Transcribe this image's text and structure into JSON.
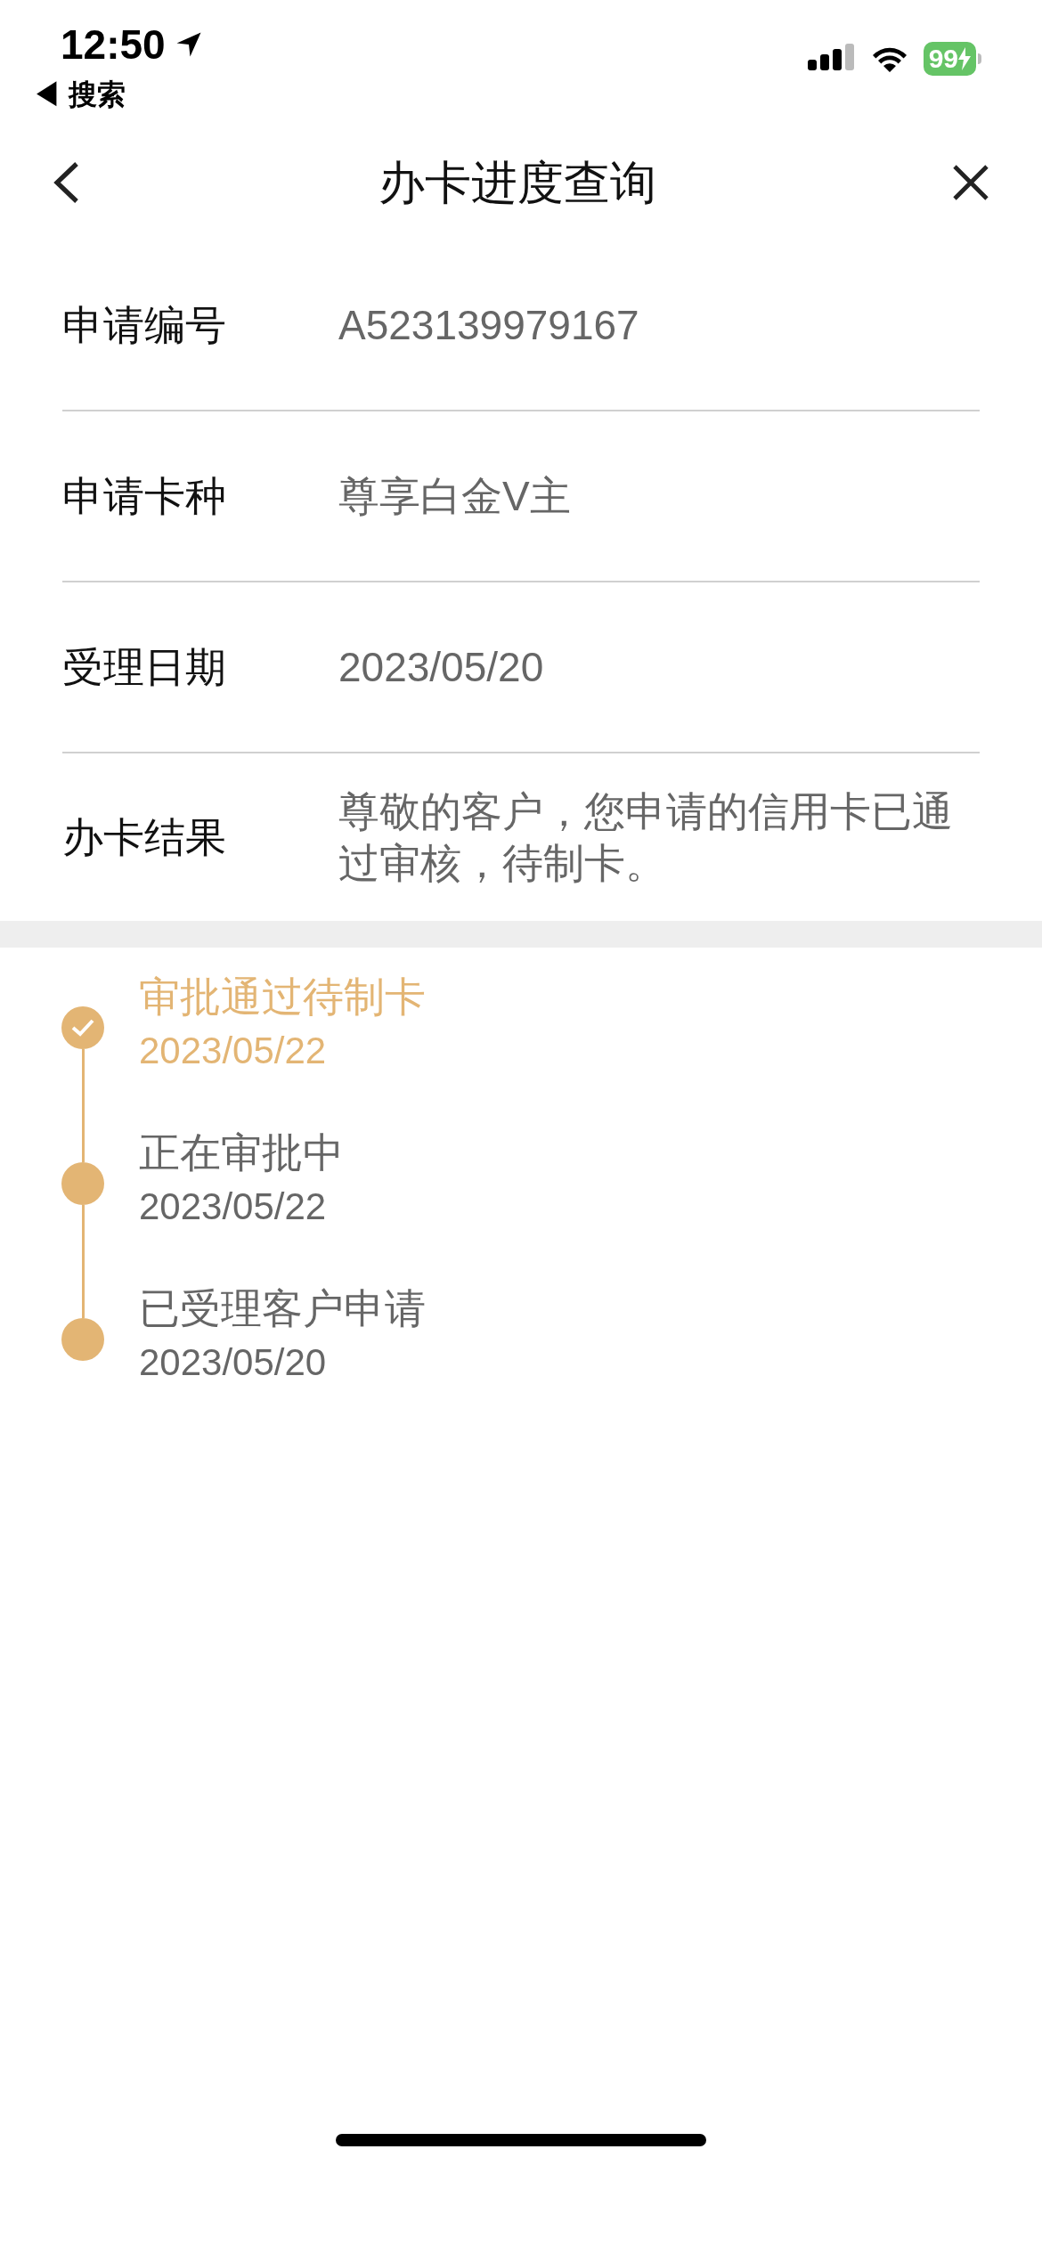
{
  "status_bar": {
    "time": "12:50",
    "back_label": "◀ 搜索",
    "battery": "99"
  },
  "nav": {
    "title": "办卡进度查询"
  },
  "fields": [
    {
      "label": "申请编号",
      "value": "A523139979167"
    },
    {
      "label": "申请卡种",
      "value": "尊享白金V主"
    },
    {
      "label": "受理日期",
      "value": "2023/05/20"
    },
    {
      "label": "办卡结果",
      "value": "尊敬的客户，您申请的信用卡已通过审核，待制卡。"
    }
  ],
  "timeline": [
    {
      "title": "审批通过待制卡",
      "date": "2023/05/22",
      "current": true
    },
    {
      "title": "正在审批中",
      "date": "2023/05/22",
      "current": false
    },
    {
      "title": "已受理客户申请",
      "date": "2023/05/20",
      "current": false
    }
  ]
}
